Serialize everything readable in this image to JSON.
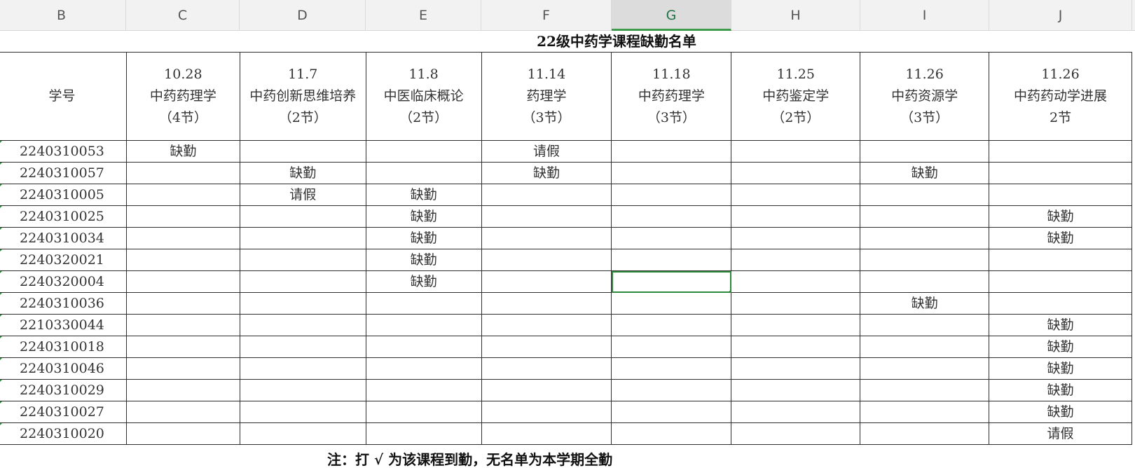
{
  "column_headers": [
    {
      "letter": "B",
      "width": 184
    },
    {
      "letter": "C",
      "width": 162
    },
    {
      "letter": "D",
      "width": 180
    },
    {
      "letter": "E",
      "width": 165
    },
    {
      "letter": "F",
      "width": 186
    },
    {
      "letter": "G",
      "width": 171
    },
    {
      "letter": "H",
      "width": 184
    },
    {
      "letter": "I",
      "width": 184
    },
    {
      "letter": "J",
      "width": 204
    }
  ],
  "active_column": "G",
  "title": "22级中药学课程缺勤名单",
  "table": {
    "headers": [
      "学号",
      "10.28\n中药药理学\n（4节）",
      "11.7\n中药创新思维培养\n（2节）",
      "11.8\n中医临床概论\n（2节）",
      "11.14\n药理学\n（3节）",
      "11.18\n中药药理学\n（3节）",
      "11.25\n中药鉴定学\n（2节）",
      "11.26\n中药资源学\n（3节）",
      "11.26\n中药药动学进展\n2节"
    ],
    "rows": [
      [
        "2240310053",
        "缺勤",
        "",
        "",
        "请假",
        "",
        "",
        "",
        ""
      ],
      [
        "2240310057",
        "",
        "缺勤",
        "",
        "缺勤",
        "",
        "",
        "缺勤",
        ""
      ],
      [
        "2240310005",
        "",
        "请假",
        "缺勤",
        "",
        "",
        "",
        "",
        ""
      ],
      [
        "2240310025",
        "",
        "",
        "缺勤",
        "",
        "",
        "",
        "",
        "缺勤"
      ],
      [
        "2240310034",
        "",
        "",
        "缺勤",
        "",
        "",
        "",
        "",
        "缺勤"
      ],
      [
        "2240320021",
        "",
        "",
        "缺勤",
        "",
        "",
        "",
        "",
        ""
      ],
      [
        "2240320004",
        "",
        "",
        "缺勤",
        "",
        "",
        "",
        "",
        ""
      ],
      [
        "2240310036",
        "",
        "",
        "",
        "",
        "",
        "",
        "缺勤",
        ""
      ],
      [
        "2210330044",
        "",
        "",
        "",
        "",
        "",
        "",
        "",
        "缺勤"
      ],
      [
        "2240310018",
        "",
        "",
        "",
        "",
        "",
        "",
        "",
        "缺勤"
      ],
      [
        "2240310046",
        "",
        "",
        "",
        "",
        "",
        "",
        "",
        "缺勤"
      ],
      [
        "2240310029",
        "",
        "",
        "",
        "",
        "",
        "",
        "",
        "缺勤"
      ],
      [
        "2240310027",
        "",
        "",
        "",
        "",
        "",
        "",
        "",
        "缺勤"
      ],
      [
        "2240310020",
        "",
        "",
        "",
        "",
        "",
        "",
        "",
        "请假"
      ]
    ]
  },
  "selected_cell": {
    "row": 6,
    "col": 5
  },
  "note": "注：打 √ 为该课程到勤，无名单为本学期全勤"
}
